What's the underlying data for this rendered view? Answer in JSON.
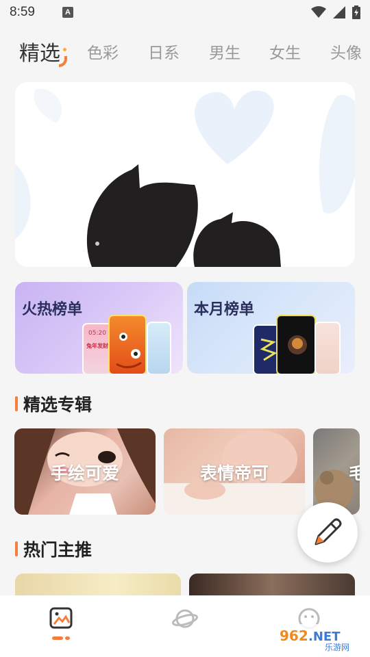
{
  "status_bar": {
    "time": "8:59",
    "notification_icon": "A"
  },
  "tabs": [
    {
      "label": "精选",
      "active": true
    },
    {
      "label": "色彩",
      "active": false
    },
    {
      "label": "日系",
      "active": false
    },
    {
      "label": "男生",
      "active": false
    },
    {
      "label": "女生",
      "active": false
    },
    {
      "label": "头像",
      "active": false
    }
  ],
  "rankings": {
    "hot": {
      "title": "火热榜单",
      "phone_text": "05:20",
      "phone_caption": "兔年发财"
    },
    "month": {
      "title": "本月榜单"
    }
  },
  "featured": {
    "title": "精选专辑",
    "albums": [
      {
        "label": "手绘可爱"
      },
      {
        "label": "表情帝可"
      },
      {
        "label": "毛"
      }
    ]
  },
  "hot_picks": {
    "title": "热门主推"
  },
  "bottom_nav": {
    "items": [
      {
        "icon": "wallpaper-icon",
        "active": true
      },
      {
        "icon": "planet-icon",
        "active": false
      },
      {
        "icon": "smile-face-icon",
        "active": false
      }
    ]
  },
  "watermark": {
    "brand": "962.NET",
    "subtitle": "乐游网"
  },
  "colors": {
    "accent": "#f47e3c",
    "hot_card": "#d9c8f7",
    "month_card": "#d9e7fa"
  }
}
